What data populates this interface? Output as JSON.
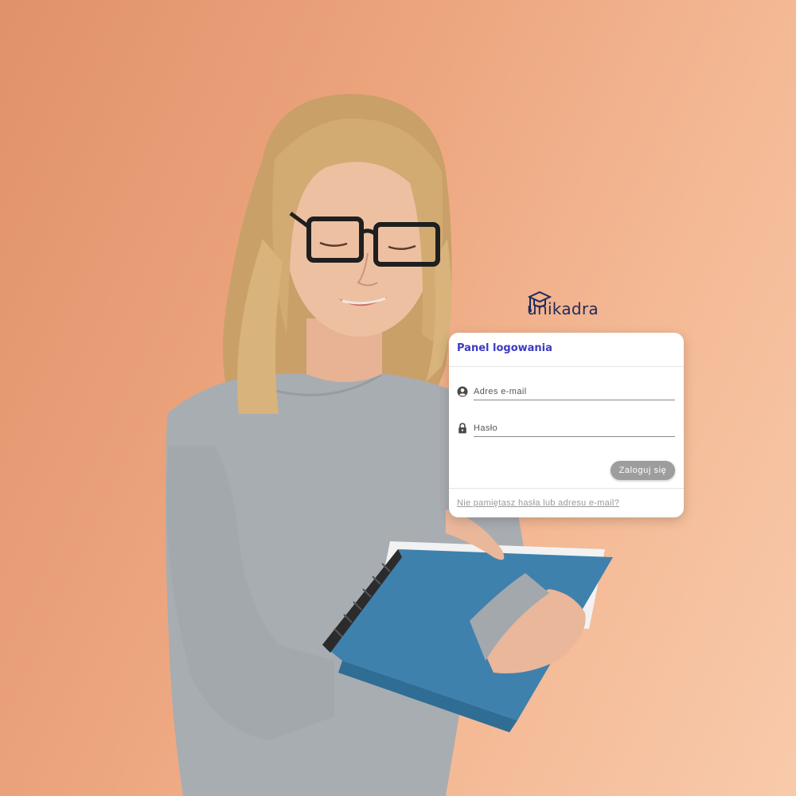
{
  "brand": {
    "logo_text": "unikadra",
    "logo_icon": "graduation-cap-icon",
    "logo_color": "#1e2a5a"
  },
  "login_panel": {
    "title": "Panel logowania",
    "title_color": "#3b3bbf",
    "email": {
      "icon": "user-circle-icon",
      "placeholder": "Adres e-mail",
      "value": ""
    },
    "password": {
      "icon": "lock-icon",
      "placeholder": "Hasło",
      "value": ""
    },
    "submit_label": "Zaloguj się",
    "submit_color": "#9d9d9d",
    "forgot_link": "Nie pamiętasz hasła lub adresu e-mail?"
  },
  "background": {
    "description_colors": [
      "#e0926a",
      "#f8caab"
    ]
  }
}
